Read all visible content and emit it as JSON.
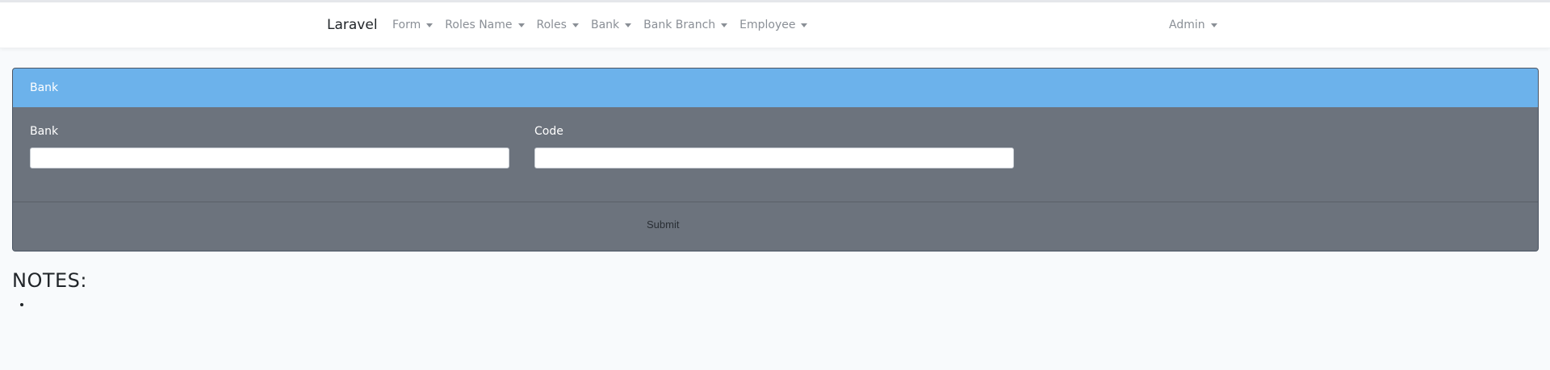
{
  "navbar": {
    "brand": "Laravel",
    "menu": [
      {
        "label": "Form"
      },
      {
        "label": "Roles Name"
      },
      {
        "label": "Roles"
      },
      {
        "label": "Bank"
      },
      {
        "label": "Bank Branch"
      },
      {
        "label": "Employee"
      }
    ],
    "user_label": "Admin"
  },
  "card": {
    "title": "Bank",
    "fields": [
      {
        "label": "Bank",
        "value": "",
        "placeholder": ""
      },
      {
        "label": "Code",
        "value": "",
        "placeholder": ""
      }
    ],
    "submit_label": "Submit"
  },
  "notes": {
    "title": "NOTES:",
    "items": [
      ""
    ]
  },
  "colors": {
    "header_blue": "#6cb2eb",
    "card_gray": "#6c737d",
    "nav_text": "#8a8f96"
  },
  "icons": {
    "dropdown": "caret-down-icon"
  }
}
